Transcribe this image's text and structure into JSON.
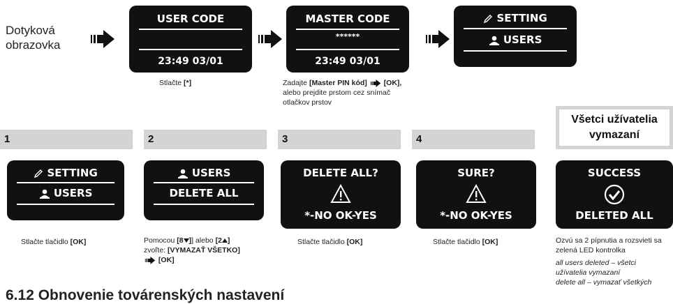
{
  "intro": {
    "line1": "Dotyková",
    "line2": "obrazovka"
  },
  "top_screens": {
    "user_code": {
      "title": "USER CODE",
      "time": "23:49  03/01"
    },
    "master_code": {
      "title": "MASTER CODE",
      "pin": "******",
      "time": "23:49  03/01"
    },
    "setting": {
      "title": "SETTING",
      "item": "USERS"
    }
  },
  "top_captions": {
    "c1": {
      "pre": "Stlačte ",
      "key": "[*]"
    },
    "c2": {
      "pre": "Zadajte ",
      "key": "[Master PIN kód]",
      "ok": "[OK],",
      "line2": "alebo prejdite prstom cez snímač",
      "line3": "otlačkov prstov"
    }
  },
  "steps": [
    {
      "num": "1"
    },
    {
      "num": "2"
    },
    {
      "num": "3"
    },
    {
      "num": "4"
    }
  ],
  "result_title": {
    "line1": "Všetci užívatelia",
    "line2": "vymazaní"
  },
  "step_screens": {
    "s1": {
      "title": "SETTING",
      "item": "USERS"
    },
    "s2": {
      "title": "USERS",
      "item": "DELETE ALL"
    },
    "s3": {
      "title": "DELETE ALL?",
      "options": "*-NO  OK-YES"
    },
    "s4": {
      "title": "SURE?",
      "options": "*-NO  OK-YES"
    },
    "s5": {
      "title": "SUCCESS",
      "item": "DELETED ALL"
    }
  },
  "step_captions": {
    "s1": {
      "pre": "Stlačte tlačidlo ",
      "key": "[OK]"
    },
    "s2": {
      "pre": "Pomocou ",
      "k1": "[8",
      "mid": "] alebo ",
      "k2": "[2",
      "end": "]",
      "line2a": "zvoľte: ",
      "line2b": "[VYMAZAŤ VŠETKO]",
      "line3": "[OK]"
    },
    "s3": {
      "pre": "Stlačte tlačidlo ",
      "key": "[OK]"
    },
    "s4": {
      "pre": "Stlačte tlačidlo ",
      "key": "[OK]"
    },
    "s5": {
      "line1": "Ozvú sa 2 pípnutia a rozsvieti sa",
      "line2": "zelená LED kontrolka",
      "it1": "all users deleted – všetci",
      "it2": "užívatelia vymazaní",
      "it3": "delete all – vymazať všetkých"
    }
  },
  "section_heading": "6.12 Obnovenie továrenských nastavení"
}
